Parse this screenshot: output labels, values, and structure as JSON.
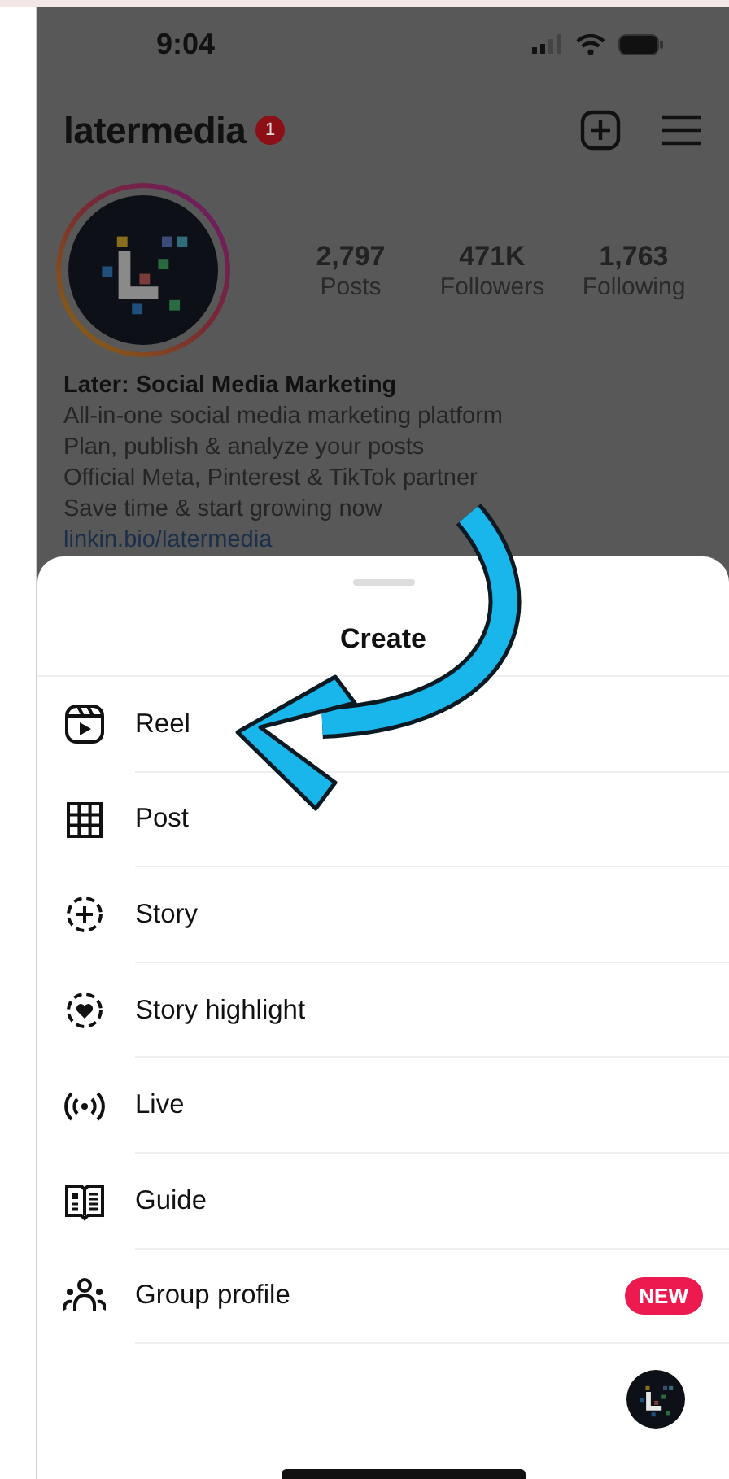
{
  "status_bar": {
    "time": "9:04"
  },
  "profile": {
    "username": "latermedia",
    "notification_count": "1",
    "stats": [
      {
        "value": "2,797",
        "label": "Posts"
      },
      {
        "value": "471K",
        "label": "Followers"
      },
      {
        "value": "1,763",
        "label": "Following"
      }
    ],
    "name": "Later: Social Media Marketing",
    "bio": [
      "All-in-one social media marketing platform",
      "Plan, publish & analyze your posts",
      "Official Meta, Pinterest & TikTok partner",
      "Save time & start growing now"
    ],
    "link": "linkin.bio/latermedia"
  },
  "create_sheet": {
    "title": "Create",
    "items": [
      {
        "kind": "reel",
        "label": "Reel"
      },
      {
        "kind": "post",
        "label": "Post"
      },
      {
        "kind": "story",
        "label": "Story"
      },
      {
        "kind": "highlight",
        "label": "Story highlight"
      },
      {
        "kind": "live",
        "label": "Live"
      },
      {
        "kind": "guide",
        "label": "Guide"
      },
      {
        "kind": "group",
        "label": "Group profile",
        "badge": "NEW"
      }
    ]
  }
}
